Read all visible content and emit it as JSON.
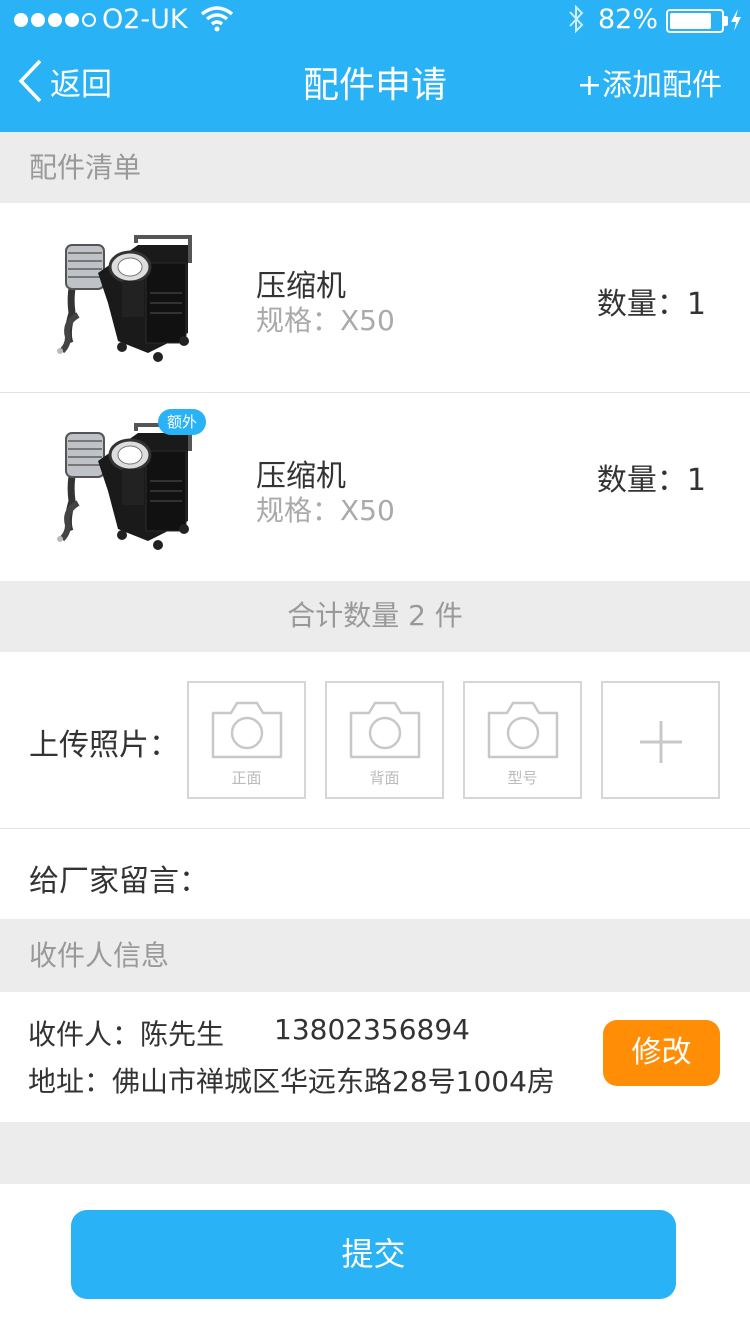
{
  "status_bar": {
    "carrier": "O2-UK",
    "battery": "82%",
    "battery_level": 0.82
  },
  "nav": {
    "back_label": "返回",
    "title": "配件申请",
    "add_label": "+添加配件"
  },
  "parts_section": {
    "title": "配件清单",
    "items": [
      {
        "name": "压缩机",
        "spec": "规格：X50",
        "qty": "数量：1",
        "badge": ""
      },
      {
        "name": "压缩机",
        "spec": "规格：X50",
        "qty": "数量：1",
        "badge": "额外"
      }
    ],
    "total": "合计数量 2 件"
  },
  "upload": {
    "label": "上传照片：",
    "slots": [
      "正面",
      "背面",
      "型号"
    ]
  },
  "message": {
    "label": "给厂家留言："
  },
  "receiver_section": {
    "title": "收件人信息",
    "name_line": "收件人：陈先生",
    "phone": "13802356894",
    "address": "地址：佛山市禅城区华远东路28号1004房",
    "edit_label": "修改"
  },
  "submit_label": "提交",
  "colors": {
    "primary": "#2ab2f6",
    "accent": "#ff8d06",
    "background": "#ececec"
  }
}
